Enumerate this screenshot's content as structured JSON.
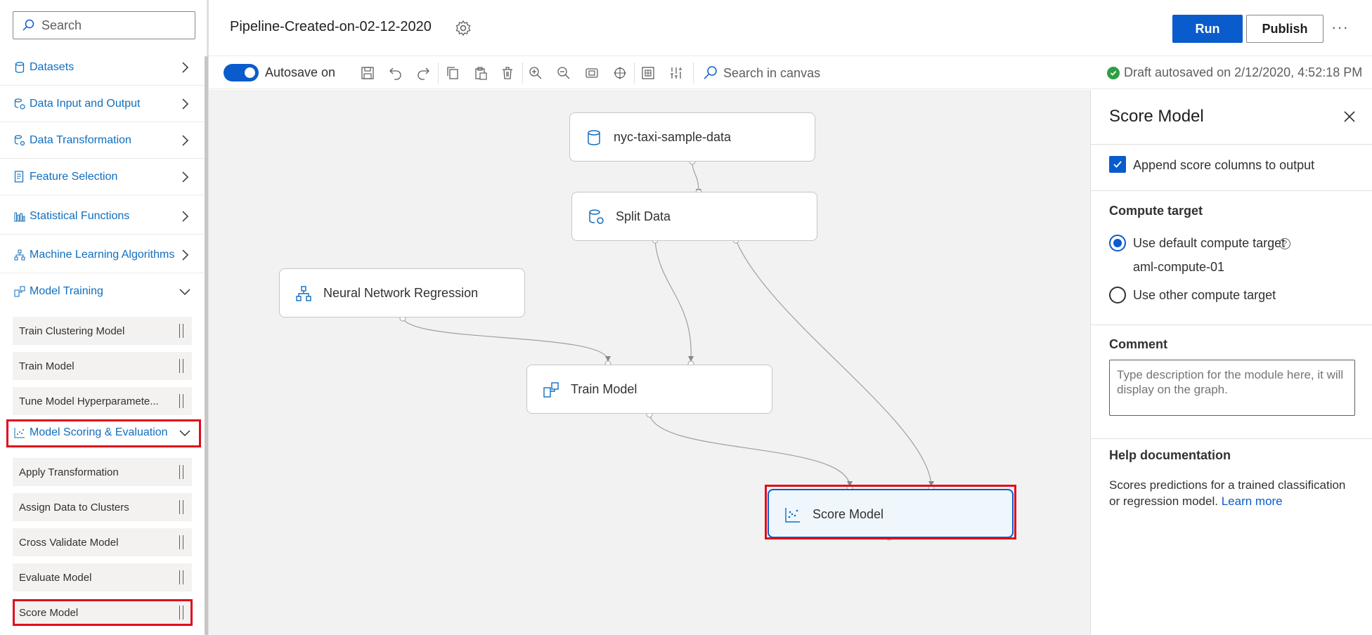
{
  "sidebar": {
    "search_placeholder": "Search",
    "categories": [
      {
        "label": "Datasets",
        "icon": "cylinder-icon",
        "state": "collapsed"
      },
      {
        "label": "Data Input and Output",
        "icon": "data-io-icon",
        "state": "collapsed"
      },
      {
        "label": "Data Transformation",
        "icon": "data-transform-icon",
        "state": "collapsed"
      },
      {
        "label": "Feature Selection",
        "icon": "feature-select-icon",
        "state": "collapsed"
      },
      {
        "label": "Statistical Functions",
        "icon": "bar-chart-icon",
        "state": "collapsed"
      },
      {
        "label": "Machine Learning Algorithms",
        "icon": "ml-algorithm-icon",
        "state": "collapsed"
      },
      {
        "label": "Model Training",
        "icon": "model-training-icon",
        "state": "expanded"
      },
      {
        "label": "Model Scoring & Evaluation",
        "icon": "scatter-icon",
        "state": "expanded"
      }
    ],
    "training_modules": [
      "Train Clustering Model",
      "Train Model",
      "Tune Model Hyperparamete..."
    ],
    "scoring_modules": [
      "Apply Transformation",
      "Assign Data to Clusters",
      "Cross Validate Model",
      "Evaluate Model",
      "Score Model"
    ]
  },
  "header": {
    "title": "Pipeline-Created-on-02-12-2020",
    "run_label": "Run",
    "publish_label": "Publish",
    "more_label": "···"
  },
  "toolbar": {
    "autosave_label": "Autosave on",
    "autosave_on": true,
    "search_placeholder": "Search in canvas",
    "status": "Draft autosaved on 2/12/2020, 4:52:18 PM",
    "status_color": "#2f9e44"
  },
  "canvas": {
    "nodes": [
      {
        "label": "nyc-taxi-sample-data",
        "icon": "cylinder-icon"
      },
      {
        "label": "Split Data",
        "icon": "data-transform-icon"
      },
      {
        "label": "Neural Network Regression",
        "icon": "ml-algorithm-icon"
      },
      {
        "label": "Train Model",
        "icon": "model-training-icon"
      },
      {
        "label": "Score Model",
        "icon": "scatter-icon",
        "selected": true
      }
    ]
  },
  "panel": {
    "title": "Score Model",
    "append_label": "Append score columns to output",
    "append_checked": true,
    "compute_heading": "Compute target",
    "default_compute_label": "Use default compute target",
    "default_compute_name": "aml-compute-01",
    "other_compute_label": "Use other compute target",
    "selected_compute": "default",
    "comment_heading": "Comment",
    "comment_placeholder": "Type description for the module here, it will display on the graph.",
    "help_heading": "Help documentation",
    "help_text": "Scores predictions for a trained classification or regression model.",
    "help_link": "Learn more"
  },
  "colors": {
    "accent": "#0a5ccc",
    "highlight": "#e00b1c",
    "link": "#106ebe"
  }
}
